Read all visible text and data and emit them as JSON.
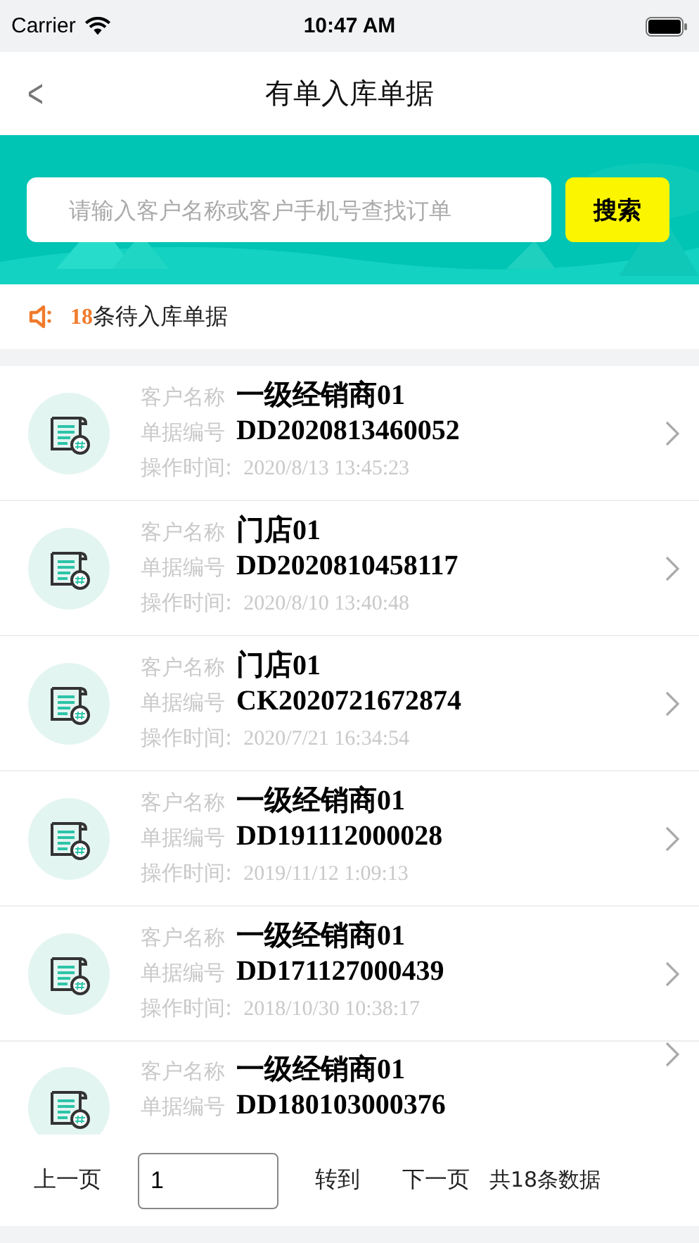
{
  "status_bar": {
    "carrier": "Carrier",
    "time": "10:47 AM"
  },
  "nav": {
    "back": "<",
    "title": "有单入库单据"
  },
  "search": {
    "placeholder": "请输入客户名称或客户手机号查找订单",
    "button": "搜索"
  },
  "notice": {
    "count": "18",
    "text": "条待入库单据"
  },
  "orders": [
    {
      "customer_label": "客户名称",
      "customer": "一级经销商01",
      "number_label": "单据编号",
      "number": "DD2020813460052",
      "time_label": "操作时间:",
      "time": "2020/8/13 13:45:23"
    },
    {
      "customer_label": "客户名称",
      "customer": "门店01",
      "number_label": "单据编号",
      "number": "DD2020810458117",
      "time_label": "操作时间:",
      "time": "2020/8/10 13:40:48"
    },
    {
      "customer_label": "客户名称",
      "customer": "门店01",
      "number_label": "单据编号",
      "number": "CK2020721672874",
      "time_label": "操作时间:",
      "time": "2020/7/21 16:34:54"
    },
    {
      "customer_label": "客户名称",
      "customer": "一级经销商01",
      "number_label": "单据编号",
      "number": "DD191112000028",
      "time_label": "操作时间:",
      "time": "2019/11/12 1:09:13"
    },
    {
      "customer_label": "客户名称",
      "customer": "一级经销商01",
      "number_label": "单据编号",
      "number": "DD171127000439",
      "time_label": "操作时间:",
      "time": "2018/10/30 10:38:17"
    },
    {
      "customer_label": "客户名称",
      "customer": "一级经销商01",
      "number_label": "单据编号",
      "number": "DD180103000376"
    }
  ],
  "pagination": {
    "prev": "上一页",
    "page": "1",
    "goto": "转到",
    "next": "下一页",
    "total": "共18条数据"
  }
}
